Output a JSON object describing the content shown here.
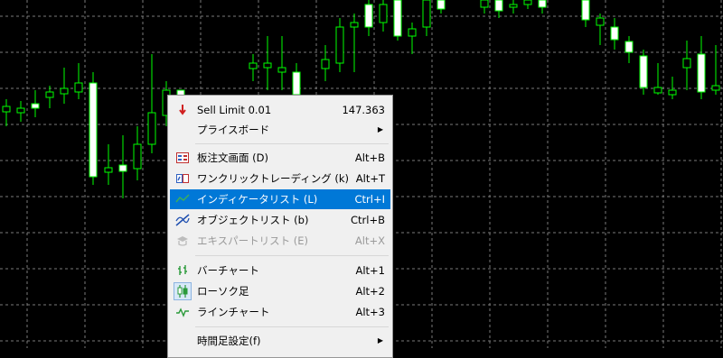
{
  "colors": {
    "background": "#000000",
    "grid": "#7a7a7a",
    "candle_up": "#000000",
    "candle_down": "#ffffff",
    "wick": "#00ff00",
    "menu_bg": "#f0f0f0",
    "menu_selected": "#0078d7"
  },
  "menu": {
    "items": [
      {
        "label": "Sell Limit 0.01",
        "shortcut": "147.363",
        "icon": "sell-limit-icon"
      },
      {
        "label": "プライスボード",
        "submenu": true
      },
      {
        "label": "板注文画面 (D)",
        "shortcut": "Alt+B",
        "icon": "order-board-icon"
      },
      {
        "label": "ワンクリックトレーディング (k)",
        "shortcut": "Alt+T",
        "icon": "one-click-trading-icon"
      },
      {
        "label": "インディケータリスト (L)",
        "shortcut": "Ctrl+I",
        "icon": "indicator-list-icon",
        "selected": true
      },
      {
        "label": "オブジェクトリスト (b)",
        "shortcut": "Ctrl+B",
        "icon": "object-list-icon"
      },
      {
        "label": "エキスパートリスト (E)",
        "shortcut": "Alt+X",
        "icon": "expert-list-icon",
        "disabled": true
      },
      {
        "label": "バーチャート",
        "shortcut": "Alt+1",
        "icon": "bar-chart-icon"
      },
      {
        "label": "ローソク足",
        "shortcut": "Alt+2",
        "icon": "candlestick-icon",
        "checked": true
      },
      {
        "label": "ラインチャート",
        "shortcut": "Alt+3",
        "icon": "line-chart-icon"
      },
      {
        "label": "時間足設定(f)",
        "submenu": true
      }
    ]
  }
}
